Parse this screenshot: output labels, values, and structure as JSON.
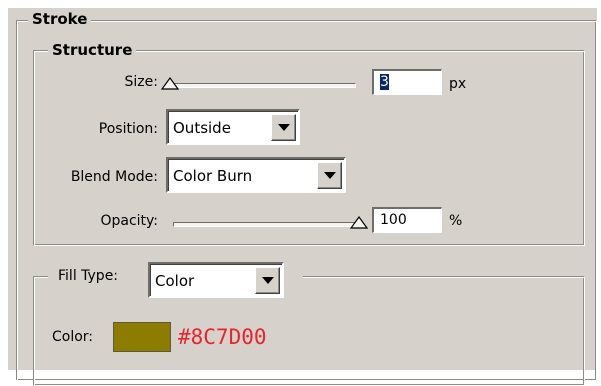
{
  "stroke": {
    "title": "Stroke",
    "structure": {
      "title": "Structure",
      "size": {
        "label": "Size:",
        "value": "3",
        "unit": "px",
        "slider_fraction": 0.0
      },
      "position": {
        "label": "Position:",
        "value": "Outside"
      },
      "blend_mode": {
        "label": "Blend Mode:",
        "value": "Color Burn"
      },
      "opacity": {
        "label": "Opacity:",
        "value": "100",
        "unit": "%",
        "slider_fraction": 1.0
      }
    },
    "fill": {
      "label": "Fill Type:",
      "type_value": "Color",
      "color_label": "Color:",
      "color_hex": "#8C7D00",
      "color_text_color": "#e8242c"
    }
  },
  "icons": [
    "slider-thumb-icon",
    "dropdown-arrow-icon"
  ],
  "colors": {
    "panel": "#d6d2cb",
    "swatch": "#8C7D00"
  }
}
